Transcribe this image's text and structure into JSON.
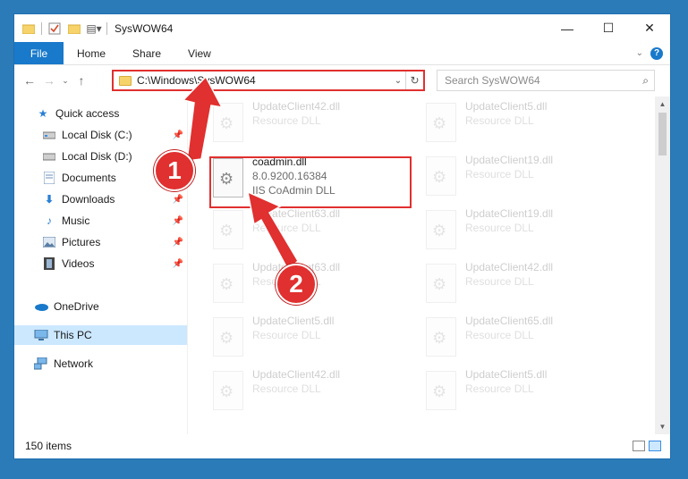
{
  "window": {
    "title": "SysWOW64"
  },
  "ribbon": {
    "file": "File",
    "tabs": [
      "Home",
      "Share",
      "View"
    ]
  },
  "address": {
    "path": "C:\\Windows\\SysWOW64",
    "search_placeholder": "Search SysWOW64"
  },
  "sidebar": {
    "items": [
      {
        "label": "Quick access",
        "icon": "star-icon"
      },
      {
        "label": "Local Disk (C:)",
        "icon": "drive-icon",
        "pinned": true
      },
      {
        "label": "Local Disk (D:)",
        "icon": "drive-icon",
        "pinned": false
      },
      {
        "label": "Documents",
        "icon": "documents-icon",
        "pinned": true
      },
      {
        "label": "Downloads",
        "icon": "downloads-icon",
        "pinned": true
      },
      {
        "label": "Music",
        "icon": "music-icon",
        "pinned": true
      },
      {
        "label": "Pictures",
        "icon": "pictures-icon",
        "pinned": true
      },
      {
        "label": "Videos",
        "icon": "videos-icon",
        "pinned": true
      },
      {
        "label": "OneDrive",
        "icon": "cloud-icon"
      },
      {
        "label": "This PC",
        "icon": "pc-icon",
        "selected": true
      },
      {
        "label": "Network",
        "icon": "network-icon"
      }
    ]
  },
  "files": [
    {
      "name": "UpdateClient42.dll",
      "desc": "Resource DLL"
    },
    {
      "name": "UpdateClient5.dll",
      "desc": "Resource DLL"
    },
    {
      "name": "coadmin.dll",
      "version": "8.0.9200.16384",
      "desc": "IIS CoAdmin DLL",
      "active": true
    },
    {
      "name": "UpdateClient19.dll",
      "desc": "Resource DLL"
    },
    {
      "name": "UpdateClient63.dll",
      "desc": "Resource DLL"
    },
    {
      "name": "UpdateClient19.dll",
      "desc": "Resource DLL"
    },
    {
      "name": "UpdateClient63.dll",
      "desc": "Resource DLL"
    },
    {
      "name": "UpdateClient42.dll",
      "desc": "Resource DLL"
    },
    {
      "name": "UpdateClient5.dll",
      "desc": "Resource DLL"
    },
    {
      "name": "UpdateClient65.dll",
      "desc": "Resource DLL"
    },
    {
      "name": "UpdateClient42.dll",
      "desc": "Resource DLL"
    },
    {
      "name": "UpdateClient5.dll",
      "desc": "Resource DLL"
    }
  ],
  "status": {
    "count": "150 items"
  },
  "markers": {
    "one": "1",
    "two": "2"
  },
  "colors": {
    "accent": "#1979ca",
    "highlight": "#e0302f",
    "selection": "#cce8ff"
  }
}
